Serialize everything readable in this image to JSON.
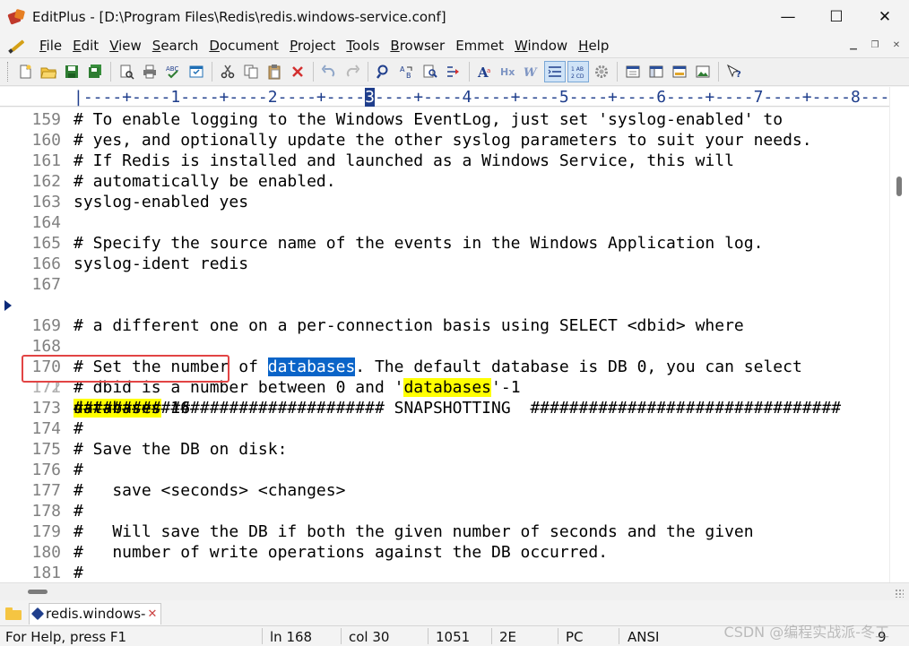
{
  "window": {
    "title": "EditPlus - [D:\\Program Files\\Redis\\redis.windows-service.conf]",
    "minimize": "—",
    "maximize": "☐",
    "close": "✕"
  },
  "menu": {
    "items": [
      {
        "key": "F",
        "rest": "ile"
      },
      {
        "key": "E",
        "rest": "dit"
      },
      {
        "key": "V",
        "rest": "iew"
      },
      {
        "key": "S",
        "rest": "earch"
      },
      {
        "key": "D",
        "rest": "ocument"
      },
      {
        "key": "P",
        "rest": "roject"
      },
      {
        "key": "T",
        "rest": "ools"
      },
      {
        "key": "B",
        "rest": "rowser"
      },
      {
        "key": "",
        "rest": "Emmet"
      },
      {
        "key": "W",
        "rest": "indow"
      },
      {
        "key": "H",
        "rest": "elp"
      }
    ],
    "mdi_minimize": "▁",
    "mdi_restore": "❐",
    "mdi_close": "✕"
  },
  "ruler": {
    "text": "|----+----1----+----2----+----",
    "cursor_char": "3",
    "text_after": "----+----4----+----5----+----6----+----7----+----8---"
  },
  "editor": {
    "lines": [
      {
        "num": "159",
        "code": "# To enable logging to the Windows EventLog, just set 'syslog-enabled' to"
      },
      {
        "num": "160",
        "code": "# yes, and optionally update the other syslog parameters to suit your needs."
      },
      {
        "num": "161",
        "code": "# If Redis is installed and launched as a Windows Service, this will"
      },
      {
        "num": "162",
        "code": "# automatically be enabled."
      },
      {
        "num": "163",
        "code": "syslog-enabled yes"
      },
      {
        "num": "164",
        "code": ""
      },
      {
        "num": "165",
        "code": "# Specify the source name of the events in the Windows Application log."
      },
      {
        "num": "166",
        "code": "syslog-ident redis"
      },
      {
        "num": "167",
        "code": ""
      },
      {
        "num": "168",
        "pre": "# Set the number of ",
        "sel": "databases",
        "post": ". The default database is DB 0, you can select"
      },
      {
        "num": "169",
        "code": "# a different one on a per-connection basis using SELECT <dbid> where"
      },
      {
        "num": "170",
        "pre": "# dbid is a number between 0 and '",
        "yel": "databases",
        "post": "'-1"
      },
      {
        "num": "171",
        "pre": "",
        "yel": "databases",
        "post": " 16"
      },
      {
        "num": "172",
        "code": ""
      },
      {
        "num": "173",
        "code": "################################ SNAPSHOTTING  ################################"
      },
      {
        "num": "174",
        "code": "#"
      },
      {
        "num": "175",
        "code": "# Save the DB on disk:"
      },
      {
        "num": "176",
        "code": "#"
      },
      {
        "num": "177",
        "code": "#   save <seconds> <changes>"
      },
      {
        "num": "178",
        "code": "#"
      },
      {
        "num": "179",
        "code": "#   Will save the DB if both the given number of seconds and the given"
      },
      {
        "num": "180",
        "code": "#   number of write operations against the DB occurred."
      },
      {
        "num": "181",
        "code": "#"
      }
    ]
  },
  "tabs": {
    "doc_label": "redis.windows-",
    "close": "✕"
  },
  "status": {
    "help": "For Help, press F1",
    "ln": "ln 168",
    "col": "col 30",
    "count": "1051",
    "hex": "2E",
    "eol": "PC",
    "encoding": "ANSI",
    "extra": "9"
  },
  "watermark": "CSDN @编程实战派-冬工",
  "colors": {
    "selection": "#0a64c8",
    "highlight": "#ffff00",
    "annotation_box": "#e24444",
    "ruler": "#1f3e8c"
  }
}
